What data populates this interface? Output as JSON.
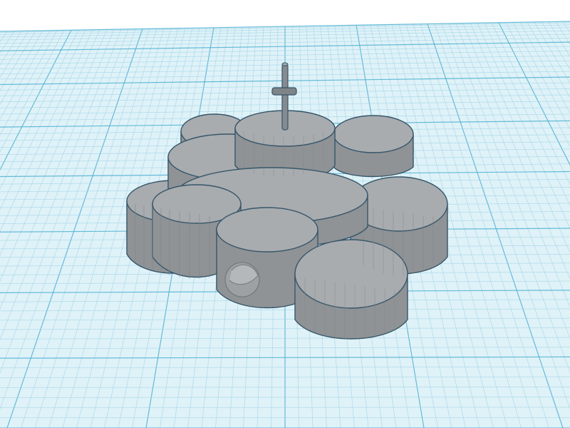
{
  "scene": {
    "background_color": "#ffffff",
    "workplane": {
      "fill_color": "#dff2f8",
      "minor_grid_color": "#9fd3e6",
      "major_grid_color": "#4fb1d2"
    },
    "object": {
      "name": "stacked-cylinder-cluster",
      "side_color": "#8f9396",
      "top_color": "#a8acaf",
      "edge_color": "#365568",
      "antenna": {
        "name": "antenna-rod"
      }
    }
  }
}
